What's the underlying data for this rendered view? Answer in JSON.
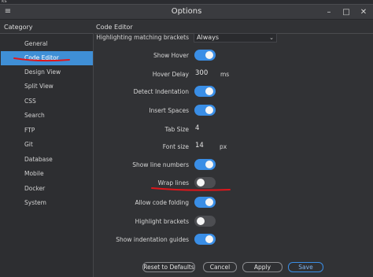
{
  "background_label": "ks",
  "window": {
    "title": "Options",
    "minimize_icon": "minimize-icon",
    "maximize_icon": "maximize-icon",
    "close_icon": "close-icon",
    "minimize_glyph": "–",
    "maximize_glyph": "□",
    "close_glyph": "✕"
  },
  "headers": {
    "category": "Category",
    "section": "Code Editor"
  },
  "sidebar": {
    "items": [
      {
        "label": "General",
        "active": false
      },
      {
        "label": "Code Editor",
        "active": true
      },
      {
        "label": "Design View",
        "active": false
      },
      {
        "label": "Split View",
        "active": false
      },
      {
        "label": "CSS",
        "active": false
      },
      {
        "label": "Search",
        "active": false
      },
      {
        "label": "FTP",
        "active": false
      },
      {
        "label": "Git",
        "active": false
      },
      {
        "label": "Database",
        "active": false
      },
      {
        "label": "Mobile",
        "active": false
      },
      {
        "label": "Docker",
        "active": false
      },
      {
        "label": "System",
        "active": false
      }
    ]
  },
  "settings": {
    "highlight_matching": {
      "label": "Highlighting matching brackets",
      "value": "Always"
    },
    "show_hover": {
      "label": "Show Hover",
      "on": true
    },
    "hover_delay": {
      "label": "Hover Delay",
      "value": "300",
      "unit": "ms"
    },
    "detect_indentation": {
      "label": "Detect Indentation",
      "on": true
    },
    "insert_spaces": {
      "label": "Insert Spaces",
      "on": true
    },
    "tab_size": {
      "label": "Tab Size",
      "value": "4"
    },
    "font_size": {
      "label": "Font size",
      "value": "14",
      "unit": "px"
    },
    "show_line_numbers": {
      "label": "Show line numbers",
      "on": true
    },
    "wrap_lines": {
      "label": "Wrap lines",
      "on": false
    },
    "allow_code_folding": {
      "label": "Allow code folding",
      "on": true
    },
    "highlight_brackets": {
      "label": "Highlight brackets",
      "on": false
    },
    "show_indentation_guides": {
      "label": "Show indentation guides",
      "on": true
    }
  },
  "buttons": {
    "reset": "Reset to Defaults",
    "cancel": "Cancel",
    "apply": "Apply",
    "save": "Save"
  },
  "colors": {
    "accent": "#3a8ee6",
    "selected_item": "#3f8fd6",
    "annotation": "#e0161b"
  }
}
